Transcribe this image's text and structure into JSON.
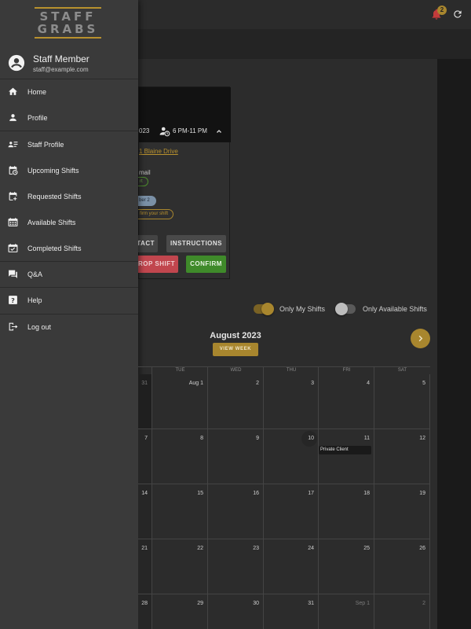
{
  "app": {
    "brand_line1": "STAFF",
    "brand_line2": "GRABS",
    "notifications_count": "2"
  },
  "drawer": {
    "user_name": "Staff Member",
    "user_email": "staff@example.com",
    "items": [
      {
        "label": "Home",
        "icon": "home-icon"
      },
      {
        "label": "Profile",
        "icon": "person-icon"
      },
      {
        "label": "Staff Profile",
        "icon": "id-card-icon"
      },
      {
        "label": "Upcoming Shifts",
        "icon": "calendar-clock-icon"
      },
      {
        "label": "Requested Shifts",
        "icon": "calendar-request-icon"
      },
      {
        "label": "Available Shifts",
        "icon": "calendar-grid-icon"
      },
      {
        "label": "Completed Shifts",
        "icon": "calendar-check-icon"
      },
      {
        "label": "Q&A",
        "icon": "forum-icon"
      },
      {
        "label": "Help",
        "icon": "help-icon"
      },
      {
        "label": "Log out",
        "icon": "logout-icon"
      }
    ]
  },
  "shift_card": {
    "date_fragment": "023",
    "time": "6 PM-11 PM",
    "address_fragment": "1 Blaine Drive",
    "email_fragment": "mail",
    "chip_green_fragment": "rt",
    "chip_blue_fragment": "ber 2",
    "chip_gold_fragment": "firm your shift",
    "contact_fragment": "TACT",
    "instructions_label": "INSTRUCTIONS",
    "drop_fragment": "ROP SHIFT",
    "confirm_label": "CONFIRM"
  },
  "filters": {
    "only_my_shifts": "Only My Shifts",
    "only_my_shifts_on": true,
    "only_available": "Only Available Shifts",
    "only_available_on": false
  },
  "calendar": {
    "month_title": "August 2023",
    "view_week_label": "VIEW WEEK",
    "days_of_week": [
      "TUE",
      "WED",
      "THU",
      "FRI",
      "SAT"
    ],
    "weeks": [
      [
        "31",
        "Aug 1",
        "2",
        "3",
        "4",
        "5"
      ],
      [
        "7",
        "8",
        "9",
        "10",
        "11",
        "12"
      ],
      [
        "14",
        "15",
        "16",
        "17",
        "18",
        "19"
      ],
      [
        "21",
        "22",
        "23",
        "24",
        "25",
        "26"
      ],
      [
        "28",
        "29",
        "30",
        "31",
        "Sep 1",
        "2"
      ]
    ],
    "event_label": "Private Client"
  },
  "colors": {
    "accent": "#a8862e",
    "confirm": "#3f8a2a",
    "drop": "#c1464e"
  }
}
